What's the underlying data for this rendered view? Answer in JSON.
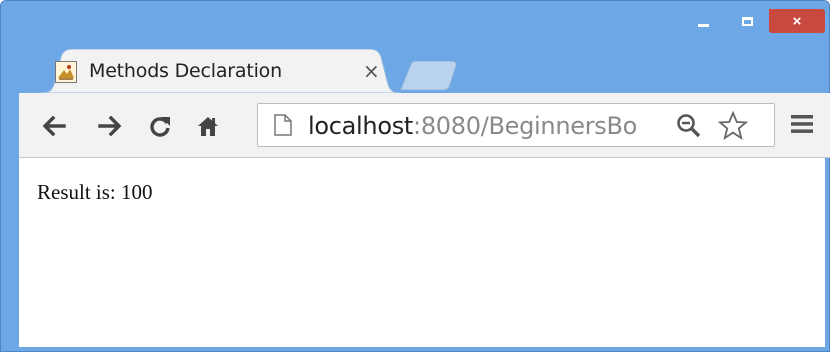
{
  "window": {
    "controls": {
      "minimize": "minimize-icon",
      "maximize": "maximize-icon",
      "close": "×"
    }
  },
  "tab": {
    "title": "Methods Declaration",
    "close": "×",
    "favicon": "java-favicon-icon"
  },
  "toolbar": {
    "back": "back-arrow-icon",
    "forward": "forward-arrow-icon",
    "reload": "reload-icon",
    "home": "home-icon",
    "address": {
      "host": "localhost",
      "rest": ":8080/BeginnersBo"
    },
    "menu": "hamburger-menu-icon"
  },
  "page": {
    "result": "Result is: 100"
  },
  "colors": {
    "frame": "#6ea7e6",
    "close_button": "#c9483f",
    "toolbar": "#f2f2f2"
  }
}
